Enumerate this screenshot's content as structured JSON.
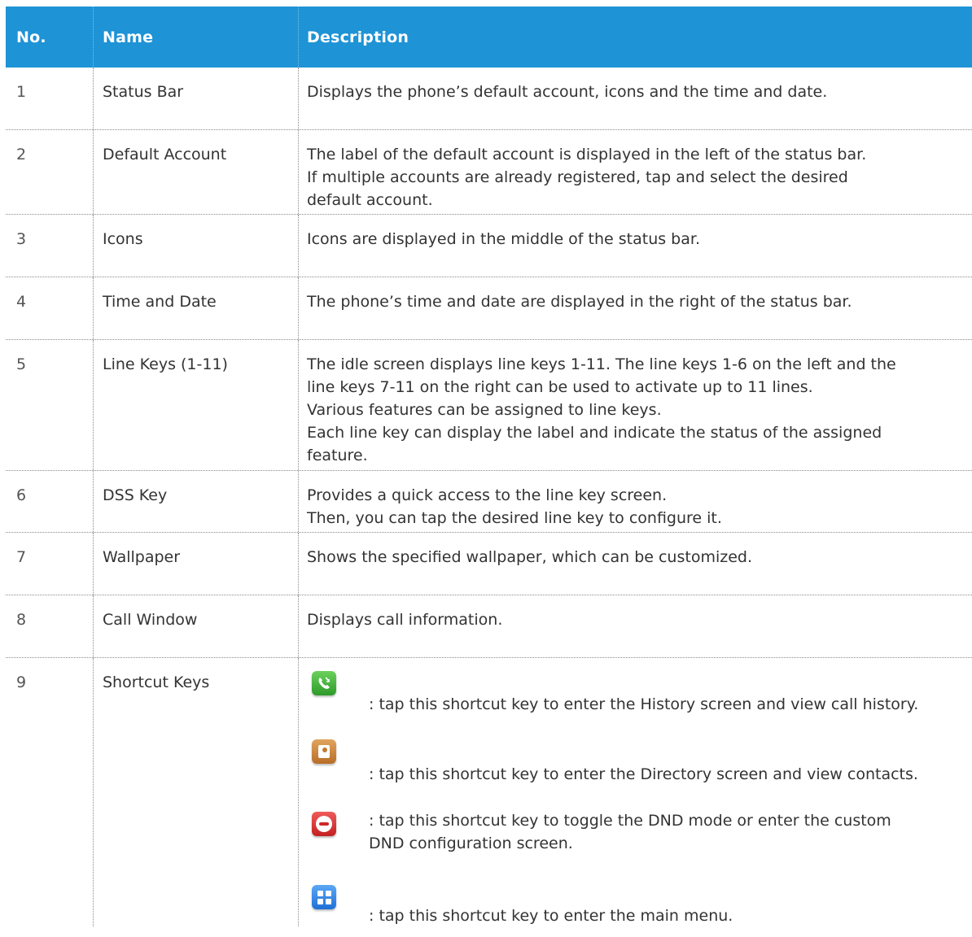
{
  "table": {
    "headers": {
      "no": "No.",
      "name": "Name",
      "description": "Description"
    },
    "rows": [
      {
        "no": "1",
        "name": "Status Bar",
        "desc": [
          "Displays the phone’s default account, icons and the time and date."
        ]
      },
      {
        "no": "2",
        "name": "Default Account",
        "desc": [
          "The label of the default account is displayed in the left of the status bar.",
          "If multiple accounts are already registered, tap and select the desired",
          "default account."
        ]
      },
      {
        "no": "3",
        "name": "Icons",
        "desc": [
          "Icons are displayed in the middle of the status bar."
        ]
      },
      {
        "no": "4",
        "name": "Time and Date",
        "desc": [
          "The phone’s time and date are displayed in the right of the status bar."
        ]
      },
      {
        "no": "5",
        "name": "Line Keys (1-11)",
        "desc": [
          "The idle screen displays line keys 1-11. The line keys 1-6 on the left and the",
          "line keys 7-11 on the right can be used to activate up to 11 lines.",
          "Various features can be assigned to line keys.",
          "Each line key can display the label and indicate the status of the assigned",
          "feature."
        ]
      },
      {
        "no": "6",
        "name": "DSS Key",
        "desc": [
          "Provides a quick access to the line key screen.",
          "Then, you can tap the desired line key to configure it."
        ]
      },
      {
        "no": "7",
        "name": "Wallpaper",
        "desc": [
          "Shows the specified wallpaper, which can be customized."
        ]
      },
      {
        "no": "8",
        "name": "Call Window",
        "desc": [
          "Displays call information."
        ]
      },
      {
        "no": "9",
        "name": "Shortcut Keys",
        "shortcuts": [
          {
            "icon": "history-icon",
            "color": "#3aa83a",
            "text": ": tap this shortcut key to enter the History screen and view call history."
          },
          {
            "icon": "directory-icon",
            "color": "#c07a30",
            "text": ": tap this shortcut key to enter the Directory screen and view contacts."
          },
          {
            "icon": "dnd-icon",
            "color": "#d02626",
            "text": ": tap this shortcut key to toggle the DND mode or enter the custom",
            "text2": "DND configuration screen."
          },
          {
            "icon": "menu-icon",
            "color": "#2b7fe0",
            "text": ": tap this shortcut key to enter the main menu."
          }
        ]
      }
    ]
  },
  "colors": {
    "header_bg": "#1e93d6",
    "header_text": "#ffffff",
    "body_text": "#333333"
  }
}
